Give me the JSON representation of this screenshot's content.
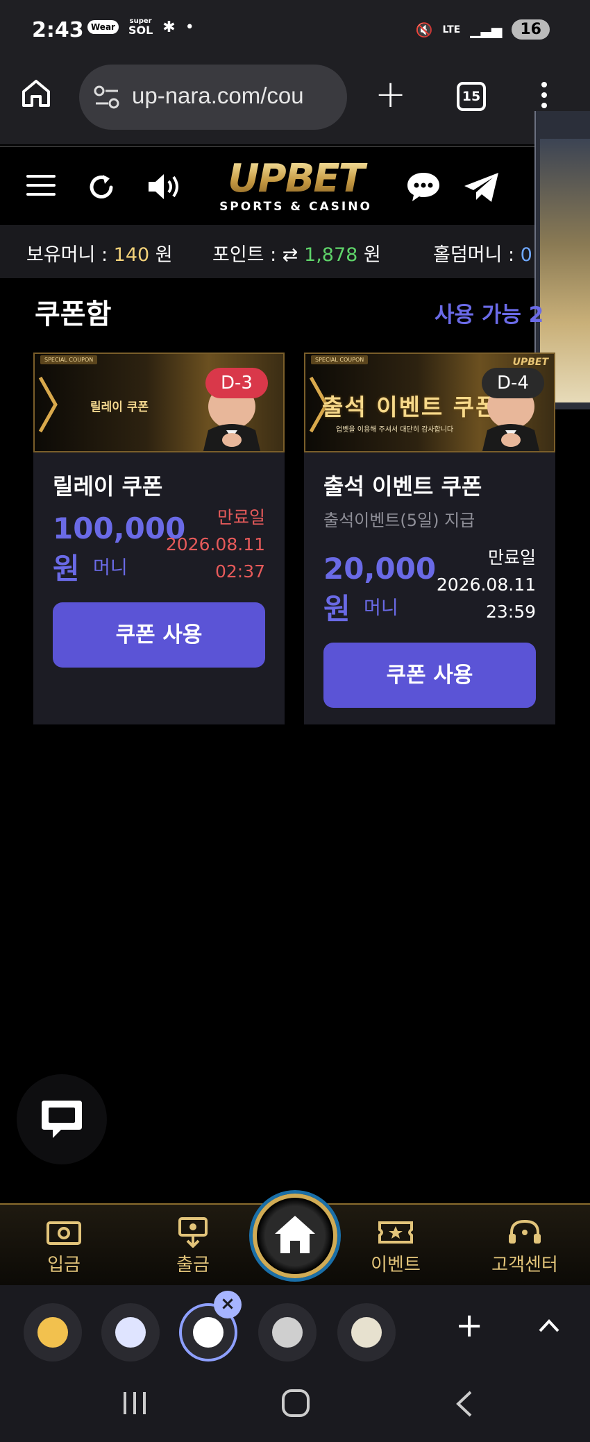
{
  "status_bar": {
    "time": "2:43",
    "chip_wear": "Wear",
    "chip_super": "super",
    "chip_sol": "SOL",
    "network": "LTE",
    "battery": "16"
  },
  "browser": {
    "url": "up-nara.com/cou",
    "tab_count": "15"
  },
  "site": {
    "logo_main": "UPBET",
    "logo_sub": "SPORTS & CASINO"
  },
  "balance": {
    "money_label": "보유머니 :",
    "money_value": "140",
    "money_unit": "원",
    "point_label": "포인트 :",
    "point_arrow": "⇄",
    "point_value": "1,878",
    "point_unit": "원",
    "holdem_label": "홀덤머니 :",
    "holdem_value": "0"
  },
  "coupon_box": {
    "title": "쿠폰함",
    "available": "사용 가능 2",
    "coupons": [
      {
        "banner_tag": "SPECIAL COUPON",
        "banner_title": "릴레이 쿠폰",
        "dday": "D-3",
        "name": "릴레이 쿠폰",
        "amount": "100,000",
        "amount_unit": "원",
        "money_label": "머니",
        "expire_label": "만료일",
        "expire_date": "2026.08.11",
        "expire_time": "02:37",
        "button": "쿠폰 사용"
      },
      {
        "banner_tag": "SPECIAL COUPON",
        "banner_title": "출석 이벤트 쿠폰",
        "banner_sub": "업벳을 이용해 주셔서 대단히 감사합니다",
        "banner_logo": "UPBET",
        "dday": "D-4",
        "name": "출석 이벤트 쿠폰",
        "desc": "출석이벤트(5일) 지급",
        "amount": "20,000",
        "amount_unit": "원",
        "money_label": "머니",
        "expire_label": "만료일",
        "expire_date": "2026.08.11",
        "expire_time": "23:59",
        "button": "쿠폰 사용"
      }
    ]
  },
  "bottom_nav": {
    "deposit": "입금",
    "withdraw": "출금",
    "event": "이벤트",
    "support": "고객센터"
  },
  "colors": {
    "accent": "#5b54d6",
    "gold": "#d0ab55",
    "red_badge": "#d9384a"
  }
}
